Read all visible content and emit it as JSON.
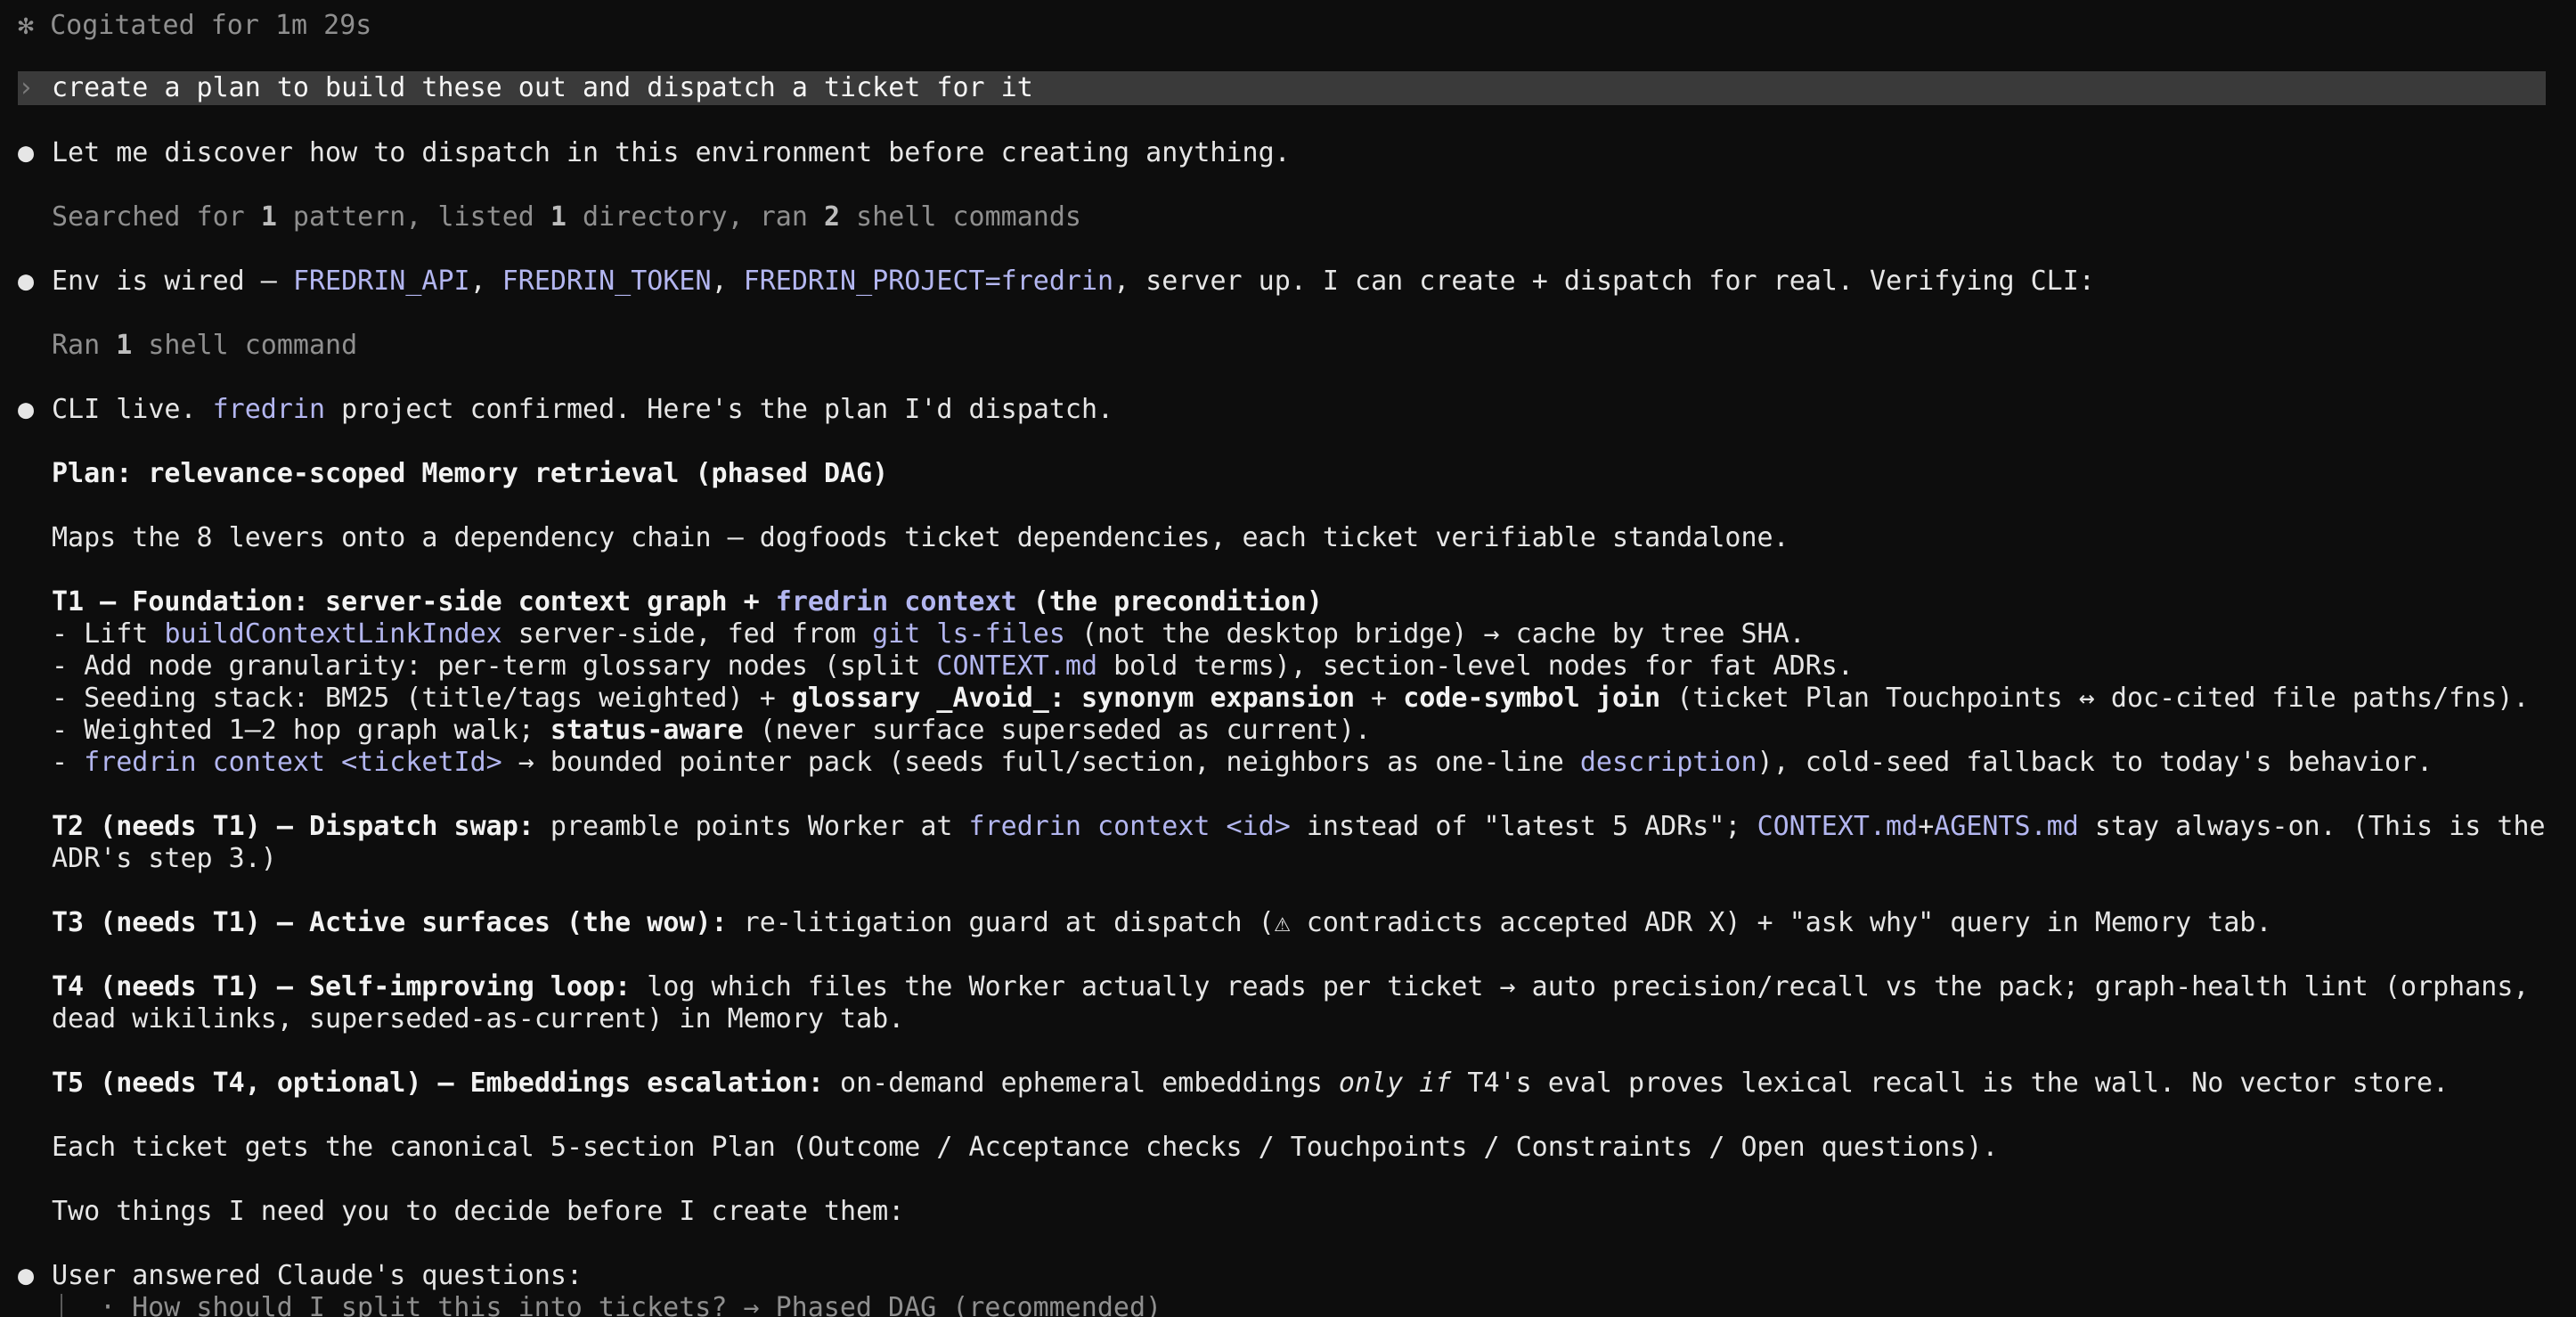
{
  "status": {
    "glyph": "✻",
    "text": "Cogitated for 1m 29s"
  },
  "prompt": {
    "caret": "›",
    "text": "create a plan to build these out and dispatch a ticket for it"
  },
  "bullet_glyph": "●",
  "messages": {
    "m1": "Let me discover how to dispatch in this environment before creating anything.",
    "tool1": {
      "a": "Searched for ",
      "n1": "1",
      "b": " pattern, listed ",
      "n2": "1",
      "c": " directory, ran ",
      "n3": "2",
      "d": " shell commands"
    },
    "m2": {
      "a": "Env is wired — ",
      "api": "FREDRIN_API",
      "sep1": ", ",
      "token": "FREDRIN_TOKEN",
      "sep2": ", ",
      "project": "FREDRIN_PROJECT=fredrin",
      "b": ", server up. I can create + dispatch for real. Verifying CLI:"
    },
    "tool2": {
      "a": "Ran ",
      "n": "1",
      "b": " shell command"
    },
    "m3": {
      "a": "CLI live. ",
      "proj": "fredrin",
      "b": " project confirmed. Here's the plan I'd dispatch."
    },
    "plan_title": "Plan: relevance-scoped Memory retrieval (phased DAG)",
    "plan_intro": "Maps the 8 levers onto a dependency chain — dogfoods ticket dependencies, each ticket verifiable standalone.",
    "t1": {
      "head_a": "T1 — Foundation: server-side context graph + ",
      "head_code": "fredrin context",
      "head_b": " (the precondition)",
      "l1_a": "- Lift ",
      "l1_code1": "buildContextLinkIndex",
      "l1_b": " server-side, fed from ",
      "l1_code2": "git ls-files",
      "l1_c": " (not the desktop bridge) → cache by tree SHA.",
      "l2_a": "- Add node granularity: per-term glossary nodes (split ",
      "l2_code": "CONTEXT.md",
      "l2_b": " bold terms), section-level nodes for fat ADRs.",
      "l3_a": "- Seeding stack: BM25 (title/tags weighted) + ",
      "l3_b1": "glossary _Avoid_:",
      "l3_c": " ",
      "l3_b2": "synonym expansion",
      "l3_d": " + ",
      "l3_b3": "code-symbol join",
      "l3_e": " (ticket Plan Touchpoints ↔ doc-cited file paths/fns).",
      "l4_a": "- Weighted 1–2 hop graph walk; ",
      "l4_b": "status-aware",
      "l4_c": " (never surface superseded as current).",
      "l5_a": "- ",
      "l5_code1": "fredrin context <ticketId>",
      "l5_b": " → bounded pointer pack (seeds full/section, neighbors as one-line ",
      "l5_code2": "description",
      "l5_c": "), cold-seed fallback to today's behavior."
    },
    "t2": {
      "head": "T2 (needs T1) — Dispatch swap:",
      "a": " preamble points Worker at ",
      "code1": "fredrin context <id>",
      "b": " instead of \"latest 5 ADRs\"; ",
      "code2": "CONTEXT.md",
      "plus": "+",
      "code3": "AGENTS.md",
      "c": " stay always-on. (This is the",
      "d": "ADR's step 3.)"
    },
    "t3": {
      "head": "T3 (needs T1) — Active surfaces (the wow):",
      "a": " re-litigation guard at dispatch (⚠ contradicts accepted ADR X) + \"ask why\" query in Memory tab."
    },
    "t4": {
      "head": "T4 (needs T1) — Self-improving loop:",
      "a": " log which files the Worker actually reads per ticket → auto precision/recall vs the pack; graph-health lint (orphans,",
      "b": "dead wikilinks, superseded-as-current) in Memory tab."
    },
    "t5": {
      "head": "T5 (needs T4, optional) — Embeddings escalation:",
      "a": " on-demand ephemeral embeddings ",
      "ital": "only if",
      "b": " T4's eval proves lexical recall is the wall. No vector store."
    },
    "each_ticket": "Each ticket gets the canonical 5-section Plan (Outcome / Acceptance checks / Touchpoints / Constraints / Open questions).",
    "two_things": "Two things I need you to decide before I create them:",
    "user_answered": "User answered Claude's questions:",
    "answer1": "· How should I split this into tickets? → Phased DAG (recommended)"
  }
}
